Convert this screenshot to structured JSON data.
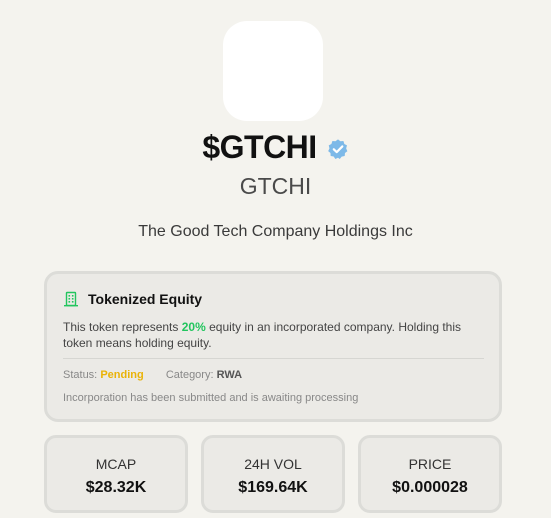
{
  "token": {
    "ticker": "$GTCHI",
    "symbol": "GTCHI",
    "company_name": "The Good Tech Company Holdings Inc",
    "verified": true,
    "verified_color": "#7db9e8"
  },
  "equity": {
    "title": "Tokenized Equity",
    "icon": "building-icon",
    "icon_color": "#22c55e",
    "desc_before": "This token represents ",
    "percentage": "20%",
    "desc_after": " equity in an incorporated company. Holding this token means holding equity.",
    "status_label": "Status:",
    "status_value": "Pending",
    "status_color": "#eab308",
    "category_label": "Category:",
    "category_value": "RWA",
    "note": "Incorporation has been submitted and is awaiting processing"
  },
  "stats": [
    {
      "label": "MCAP",
      "value": "$28.32K"
    },
    {
      "label": "24H VOL",
      "value": "$169.64K"
    },
    {
      "label": "PRICE",
      "value": "$0.000028"
    }
  ]
}
